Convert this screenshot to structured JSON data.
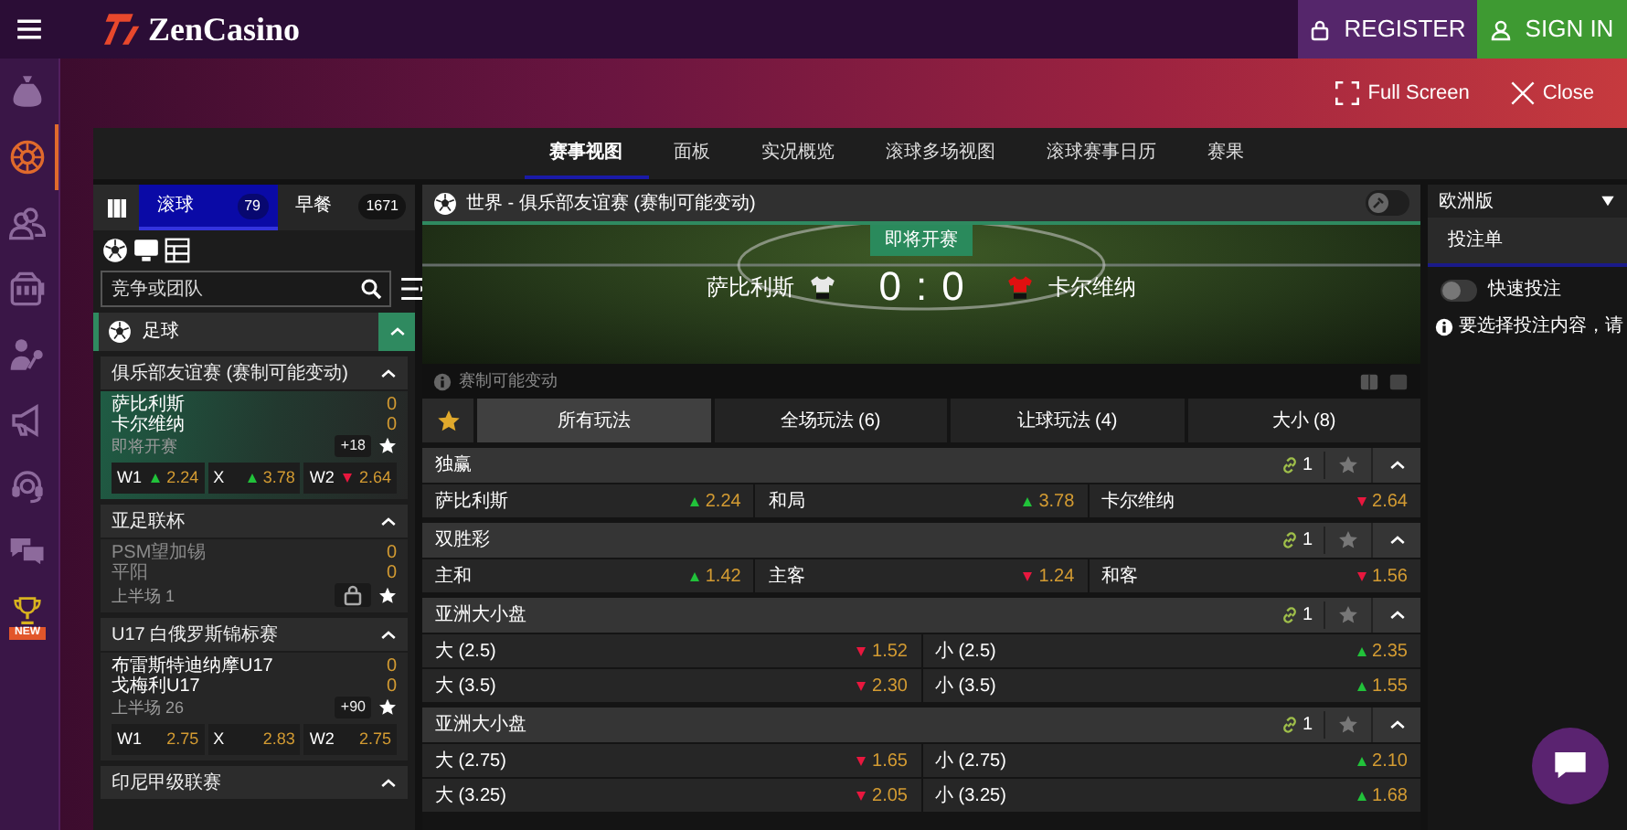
{
  "header": {
    "logo": "ZenCasino",
    "buttons": [
      {
        "label": "REGISTER",
        "kind": "register"
      },
      {
        "label": "SIGN IN",
        "kind": "signin"
      }
    ]
  },
  "sidebar": {
    "items": [
      {
        "selected": false
      },
      {
        "selected": true
      },
      {
        "selected": false
      },
      {
        "selected": false
      },
      {
        "selected": false
      },
      {
        "selected": false
      },
      {
        "selected": false
      },
      {
        "selected": false
      },
      {
        "selected": false,
        "badge": "NEW"
      }
    ]
  },
  "top_actions": [
    {
      "label": "Full Screen",
      "kind": "fullscreen"
    },
    {
      "label": "Close",
      "kind": "close"
    }
  ],
  "nav_tabs": [
    {
      "label": "赛事视图",
      "selected": true
    },
    {
      "label": "面板",
      "selected": false
    },
    {
      "label": "实况概览",
      "selected": false
    },
    {
      "label": "滚球多场视图",
      "selected": false
    },
    {
      "label": "滚球赛事日历",
      "selected": false
    },
    {
      "label": "赛果",
      "selected": false
    }
  ],
  "left_panel": {
    "tabs": [
      {
        "label": "滚球",
        "count": "79",
        "selected": true
      },
      {
        "label": "早餐",
        "count": "1671",
        "selected": false
      }
    ],
    "search": {
      "placeholder": "竞争或团队"
    },
    "sport": {
      "label": "足球",
      "expanded": true
    },
    "leagues": [
      {
        "name": "俱乐部友谊赛 (赛制可能变动)",
        "expanded": true,
        "matches": [
          {
            "home": "萨比利斯",
            "away": "卡尔维纳",
            "home_score": "0",
            "away_score": "0",
            "status": "即将开赛",
            "more": "+18",
            "selected": true,
            "suspended": false,
            "locked": false,
            "odds": [
              {
                "label": "W1",
                "value": "2.24",
                "kind": "up"
              },
              {
                "label": "X",
                "value": "3.78",
                "kind": "up"
              },
              {
                "label": "W2",
                "value": "2.64",
                "kind": "down"
              }
            ]
          }
        ]
      },
      {
        "name": "亚足联杯",
        "expanded": true,
        "matches": [
          {
            "home": "PSM望加锡",
            "away": "平阳",
            "home_score": "0",
            "away_score": "0",
            "status": "上半场 1",
            "selected": false,
            "suspended": true,
            "locked": true
          }
        ]
      },
      {
        "name": "U17 白俄罗斯锦标赛",
        "expanded": true,
        "matches": [
          {
            "home": "布雷斯特迪纳摩U17",
            "away": "戈梅利U17",
            "home_score": "0",
            "away_score": "0",
            "status": "上半场 26",
            "more": "+90",
            "selected": false,
            "suspended": false,
            "locked": false,
            "odds": [
              {
                "label": "W1",
                "value": "2.75",
                "kind": "plain"
              },
              {
                "label": "X",
                "value": "2.83",
                "kind": "plain"
              },
              {
                "label": "W2",
                "value": "2.75",
                "kind": "plain"
              }
            ]
          }
        ]
      },
      {
        "name": "印尼甲级联赛",
        "expanded": true
      }
    ]
  },
  "event": {
    "title": "世界 - 俱乐部友谊赛 (赛制可能变动)",
    "pinned": false,
    "banner": {
      "status": "即将开赛",
      "home": "萨比利斯",
      "away": "卡尔维纳",
      "home_score": "0",
      "separator": ":",
      "away_score": "0"
    },
    "notice": "赛制可能变动",
    "market_tabs": [
      {
        "label": "所有玩法",
        "selected": true
      },
      {
        "label": "全场玩法 (6)",
        "selected": false
      },
      {
        "label": "让球玩法 (4)",
        "selected": false
      },
      {
        "label": "大小 (8)",
        "selected": false
      }
    ],
    "markets": [
      {
        "title": "独赢",
        "links": "1",
        "expanded": true,
        "rows": [
          [
            {
              "label": "萨比利斯",
              "odds": "2.24",
              "kind": "up"
            },
            {
              "label": "和局",
              "odds": "3.78",
              "kind": "up"
            },
            {
              "label": "卡尔维纳",
              "odds": "2.64",
              "kind": "down"
            }
          ]
        ]
      },
      {
        "title": "双胜彩",
        "links": "1",
        "expanded": true,
        "rows": [
          [
            {
              "label": "主和",
              "odds": "1.42",
              "kind": "up"
            },
            {
              "label": "主客",
              "odds": "1.24",
              "kind": "down"
            },
            {
              "label": "和客",
              "odds": "1.56",
              "kind": "down"
            }
          ]
        ]
      },
      {
        "title": "亚洲大小盘",
        "links": "1",
        "expanded": true,
        "rows": [
          [
            {
              "label": "大 (2.5)",
              "odds": "1.52",
              "kind": "down"
            },
            {
              "label": "小 (2.5)",
              "odds": "2.35",
              "kind": "up"
            }
          ],
          [
            {
              "label": "大 (3.5)",
              "odds": "2.30",
              "kind": "down"
            },
            {
              "label": "小 (3.5)",
              "odds": "1.55",
              "kind": "up"
            }
          ]
        ]
      },
      {
        "title": "亚洲大小盘",
        "links": "1",
        "expanded": true,
        "rows": [
          [
            {
              "label": "大 (2.75)",
              "odds": "1.65",
              "kind": "down"
            },
            {
              "label": "小 (2.75)",
              "odds": "2.10",
              "kind": "up"
            }
          ],
          [
            {
              "label": "大 (3.25)",
              "odds": "2.05",
              "kind": "down"
            },
            {
              "label": "小 (3.25)",
              "odds": "1.68",
              "kind": "up"
            }
          ]
        ]
      }
    ]
  },
  "betslip": {
    "odds_format": "欧洲版",
    "tab": "投注单",
    "quick_bet": {
      "label": "快速投注",
      "on": false
    },
    "hint": "要选择投注内容，请"
  }
}
